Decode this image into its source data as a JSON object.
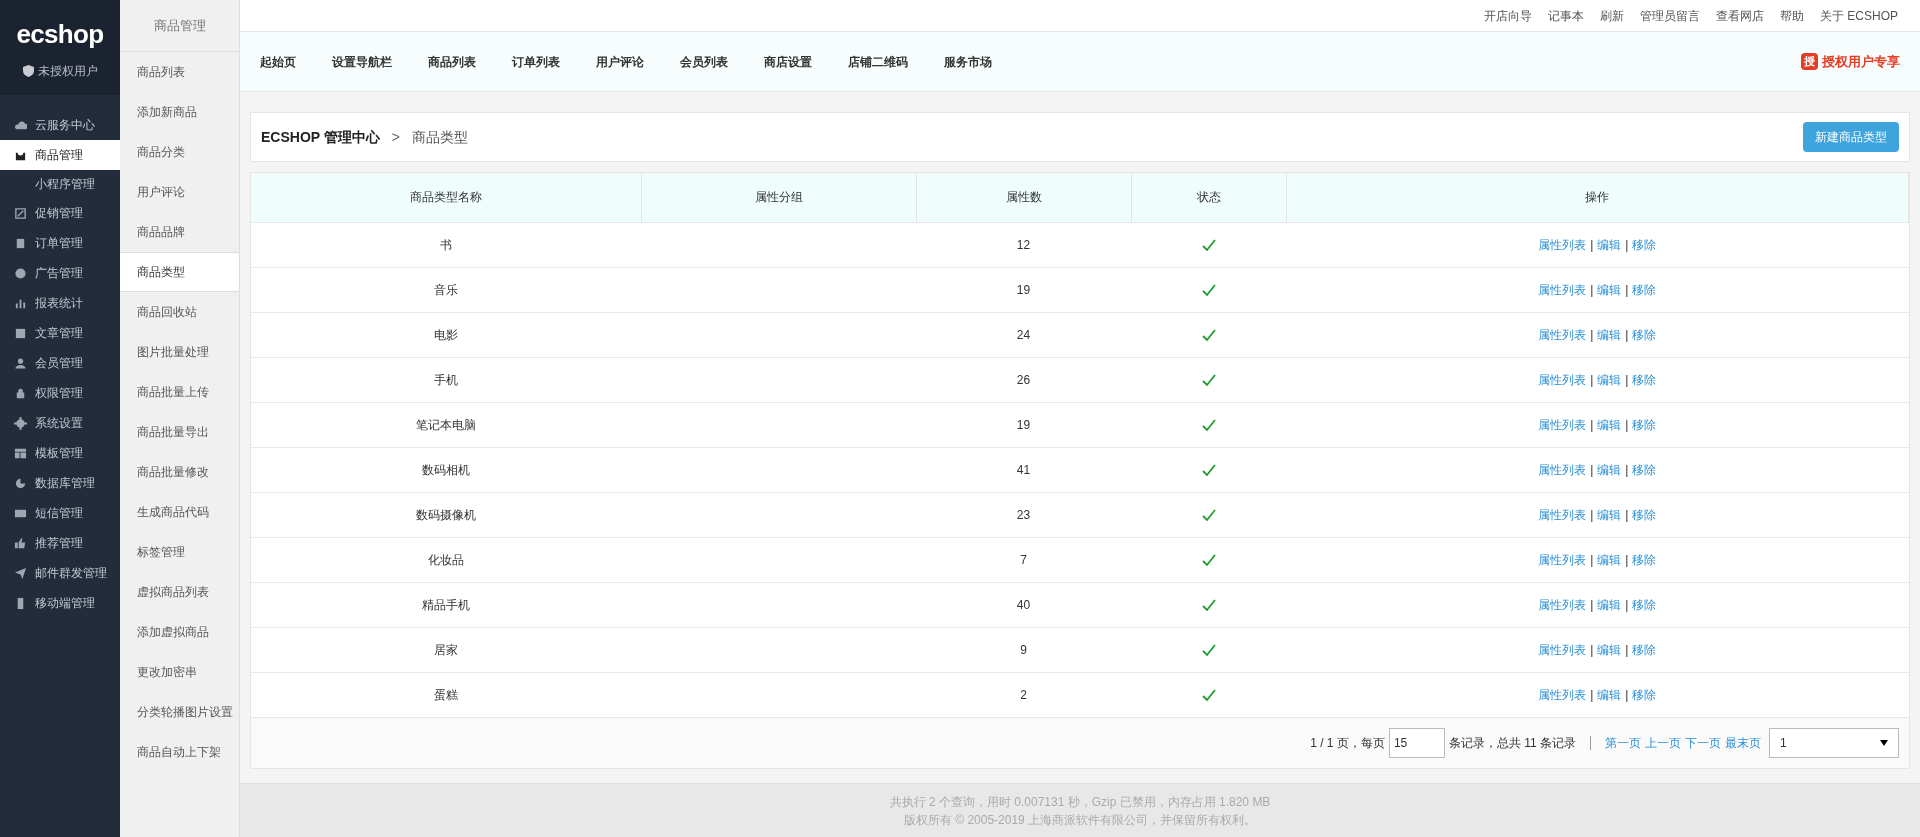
{
  "brand": {
    "logo": "ecshop",
    "user": "未授权用户"
  },
  "sidebar": {
    "items": [
      {
        "label": "云服务中心",
        "selected": false
      },
      {
        "label": "商品管理",
        "selected": true,
        "children": [
          {
            "label": "小程序管理",
            "selected": false
          }
        ]
      },
      {
        "label": "促销管理",
        "selected": false
      },
      {
        "label": "订单管理",
        "selected": false
      },
      {
        "label": "广告管理",
        "selected": false
      },
      {
        "label": "报表统计",
        "selected": false
      },
      {
        "label": "文章管理",
        "selected": false
      },
      {
        "label": "会员管理",
        "selected": false
      },
      {
        "label": "权限管理",
        "selected": false
      },
      {
        "label": "系统设置",
        "selected": false
      },
      {
        "label": "模板管理",
        "selected": false
      },
      {
        "label": "数据库管理",
        "selected": false
      },
      {
        "label": "短信管理",
        "selected": false
      },
      {
        "label": "推荐管理",
        "selected": false
      },
      {
        "label": "邮件群发管理",
        "selected": false
      },
      {
        "label": "移动端管理",
        "selected": false
      }
    ]
  },
  "submenu": {
    "title": "商品管理",
    "items": [
      {
        "label": "商品列表",
        "selected": false
      },
      {
        "label": "添加新商品",
        "selected": false
      },
      {
        "label": "商品分类",
        "selected": false
      },
      {
        "label": "用户评论",
        "selected": false
      },
      {
        "label": "商品品牌",
        "selected": false
      },
      {
        "label": "商品类型",
        "selected": true
      },
      {
        "label": "商品回收站",
        "selected": false
      },
      {
        "label": "图片批量处理",
        "selected": false
      },
      {
        "label": "商品批量上传",
        "selected": false
      },
      {
        "label": "商品批量导出",
        "selected": false
      },
      {
        "label": "商品批量修改",
        "selected": false
      },
      {
        "label": "生成商品代码",
        "selected": false
      },
      {
        "label": "标签管理",
        "selected": false
      },
      {
        "label": "虚拟商品列表",
        "selected": false
      },
      {
        "label": "添加虚拟商品",
        "selected": false
      },
      {
        "label": "更改加密串",
        "selected": false
      },
      {
        "label": "分类轮播图片设置",
        "selected": false
      },
      {
        "label": "商品自动上下架",
        "selected": false
      }
    ]
  },
  "top_links": [
    "开店向导",
    "记事本",
    "刷新",
    "管理员留言",
    "查看网店",
    "帮助",
    "关于 ECSHOP"
  ],
  "nav": {
    "items": [
      "起始页",
      "设置导航栏",
      "商品列表",
      "订单列表",
      "用户评论",
      "会员列表",
      "商店设置",
      "店铺二维码",
      "服务市场"
    ],
    "badge_icon": "授",
    "badge": "授权用户专享"
  },
  "breadcrumb": {
    "root": "ECSHOP 管理中心",
    "separator": ">",
    "current": "商品类型"
  },
  "new_button": "新建商品类型",
  "table": {
    "columns": [
      "商品类型名称",
      "属性分组",
      "属性数",
      "状态",
      "操作"
    ],
    "rows": [
      {
        "name": "书",
        "attr_count": "12",
        "enabled": true,
        "actions": [
          {
            "kind": "link",
            "text": "属性列表"
          },
          {
            "kind": "separator",
            "text": "|"
          },
          {
            "kind": "link",
            "text": "编辑"
          },
          {
            "kind": "separator",
            "text": "|"
          },
          {
            "kind": "link",
            "text": "移除"
          }
        ]
      },
      {
        "name": "音乐",
        "attr_count": "19",
        "enabled": true,
        "actions": [
          {
            "kind": "link",
            "text": "属性列表"
          },
          {
            "kind": "separator",
            "text": "|"
          },
          {
            "kind": "link",
            "text": "编辑"
          },
          {
            "kind": "separator",
            "text": "|"
          },
          {
            "kind": "link",
            "text": "移除"
          }
        ]
      },
      {
        "name": "电影",
        "attr_count": "24",
        "enabled": true,
        "actions": [
          {
            "kind": "link",
            "text": "属性列表"
          },
          {
            "kind": "separator",
            "text": "|"
          },
          {
            "kind": "link",
            "text": "编辑"
          },
          {
            "kind": "separator",
            "text": "|"
          },
          {
            "kind": "link",
            "text": "移除"
          }
        ]
      },
      {
        "name": "手机",
        "attr_count": "26",
        "enabled": true,
        "actions": [
          {
            "kind": "link",
            "text": "属性列表"
          },
          {
            "kind": "separator",
            "text": "|"
          },
          {
            "kind": "link",
            "text": "编辑"
          },
          {
            "kind": "separator",
            "text": "|"
          },
          {
            "kind": "link",
            "text": "移除"
          }
        ]
      },
      {
        "name": "笔记本电脑",
        "attr_count": "19",
        "enabled": true,
        "actions": [
          {
            "kind": "link",
            "text": "属性列表"
          },
          {
            "kind": "separator",
            "text": "|"
          },
          {
            "kind": "link",
            "text": "编辑"
          },
          {
            "kind": "separator",
            "text": "|"
          },
          {
            "kind": "link",
            "text": "移除"
          }
        ]
      },
      {
        "name": "数码相机",
        "attr_count": "41",
        "enabled": true,
        "actions": [
          {
            "kind": "link",
            "text": "属性列表"
          },
          {
            "kind": "separator",
            "text": "|"
          },
          {
            "kind": "link",
            "text": "编辑"
          },
          {
            "kind": "separator",
            "text": "|"
          },
          {
            "kind": "link",
            "text": "移除"
          }
        ]
      },
      {
        "name": "数码摄像机",
        "attr_count": "23",
        "enabled": true,
        "actions": [
          {
            "kind": "link",
            "text": "属性列表"
          },
          {
            "kind": "separator",
            "text": "|"
          },
          {
            "kind": "link",
            "text": "编辑"
          },
          {
            "kind": "separator",
            "text": "|"
          },
          {
            "kind": "link",
            "text": "移除"
          }
        ]
      },
      {
        "name": "化妆品",
        "attr_count": "7",
        "enabled": true,
        "actions": [
          {
            "kind": "link",
            "text": "属性列表"
          },
          {
            "kind": "separator",
            "text": "|"
          },
          {
            "kind": "link",
            "text": "编辑"
          },
          {
            "kind": "separator",
            "text": "|"
          },
          {
            "kind": "link",
            "text": "移除"
          }
        ]
      },
      {
        "name": "精品手机",
        "attr_count": "40",
        "enabled": true,
        "actions": [
          {
            "kind": "link",
            "text": "属性列表"
          },
          {
            "kind": "separator",
            "text": "|"
          },
          {
            "kind": "link",
            "text": "编辑"
          },
          {
            "kind": "separator",
            "text": "|"
          },
          {
            "kind": "link",
            "text": "移除"
          }
        ]
      },
      {
        "name": "居家",
        "attr_count": "9",
        "enabled": true,
        "actions": [
          {
            "kind": "link",
            "text": "属性列表"
          },
          {
            "kind": "separator",
            "text": "|"
          },
          {
            "kind": "link",
            "text": "编辑"
          },
          {
            "kind": "separator",
            "text": "|"
          },
          {
            "kind": "link",
            "text": "移除"
          }
        ]
      },
      {
        "name": "蛋糕",
        "attr_count": "2",
        "enabled": true,
        "actions": [
          {
            "kind": "link",
            "text": "属性列表"
          },
          {
            "kind": "separator",
            "text": "|"
          },
          {
            "kind": "link",
            "text": "编辑"
          },
          {
            "kind": "separator",
            "text": "|"
          },
          {
            "kind": "link",
            "text": "移除"
          }
        ]
      }
    ]
  },
  "pagination": {
    "pages": "1 / 1 页，每页",
    "page_size": "15",
    "records": "条记录，总共 11 条记录",
    "links": [
      "第一页",
      "上一页",
      "下一页",
      "最末页"
    ],
    "page_select": "1"
  },
  "footer": [
    "共执行 2 个查询，用时 0.007131 秒，Gzip 已禁用，内存占用 1.820 MB",
    "版权所有 © 2005-2019 上海商派软件有限公司，并保留所有权利。"
  ]
}
